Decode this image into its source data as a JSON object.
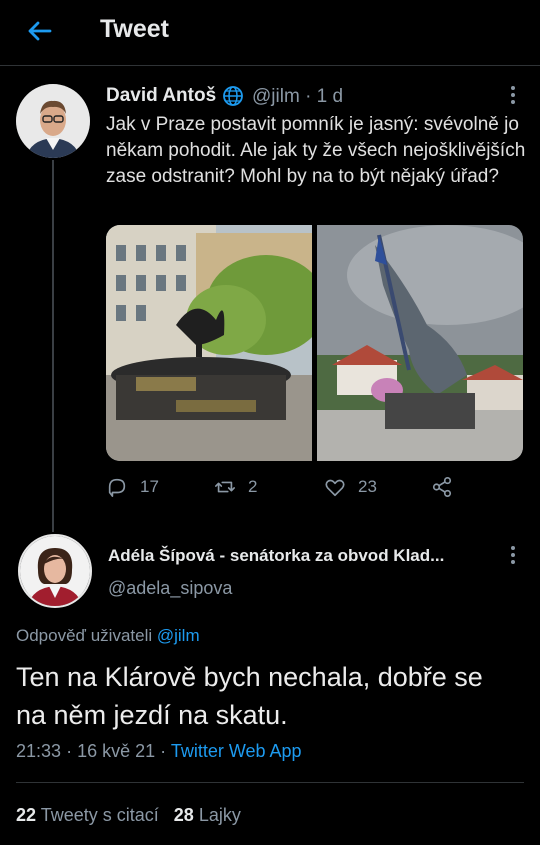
{
  "header": {
    "title": "Tweet",
    "back_icon": "arrow-left-icon",
    "accent": "#1d9bf0"
  },
  "parent_tweet": {
    "author_name": "David Antoš",
    "handle": "@jilm",
    "separator": "·",
    "time": "1 d",
    "text": "Jak v Praze postavit pomník je jasný: svévolně jo někam pohodit. Ale jak ty že všech nejošklivějších zase odstranit? Mohl by na to být nějaký úřad?",
    "replies": "17",
    "retweets": "2",
    "likes": "23"
  },
  "reply_tweet": {
    "author_name": "Adéla Šípová - senátorka za obvod Klad...",
    "handle": "@adela_sipova",
    "reply_prefix": "Odpověď uživateli",
    "reply_mention": "@jilm",
    "text": "Ten na Klárově bych nechala, dobře se na něm jezdí na skatu.",
    "time": "21:33",
    "date": "16 kvě 21",
    "source": "Twitter Web App",
    "quote_count": "22",
    "quote_label": "Tweety s citací",
    "like_count": "28",
    "like_label": "Lajky"
  }
}
